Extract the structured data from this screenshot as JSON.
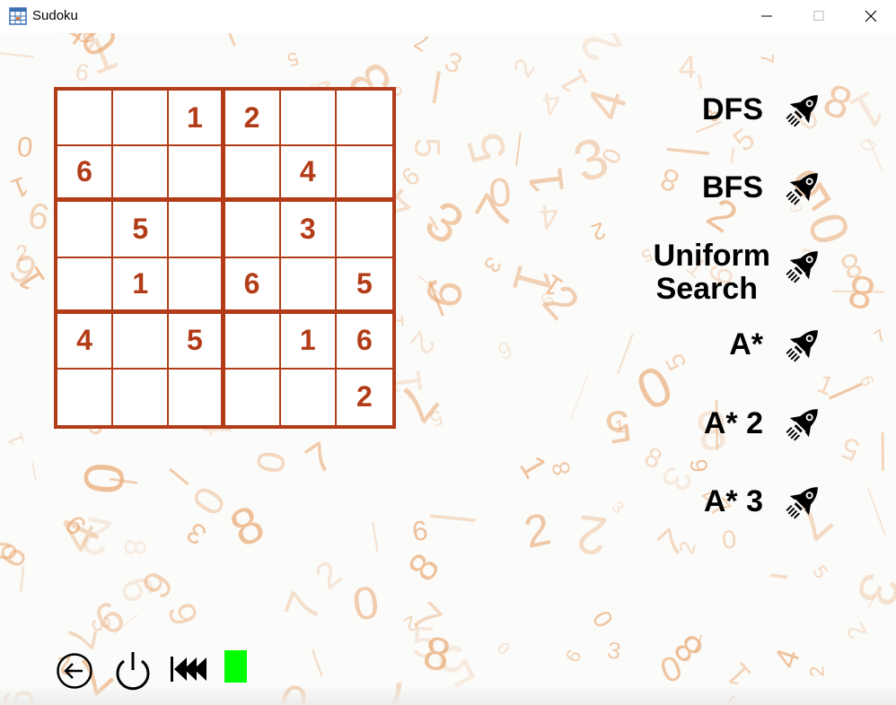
{
  "window": {
    "title": "Sudoku"
  },
  "board": {
    "size": 6,
    "rows": [
      [
        "",
        "",
        "1",
        "2",
        "",
        ""
      ],
      [
        "6",
        "",
        "",
        "",
        "4",
        ""
      ],
      [
        "",
        "5",
        "",
        "",
        "3",
        ""
      ],
      [
        "",
        "1",
        "",
        "6",
        "",
        "5"
      ],
      [
        "4",
        "",
        "5",
        "",
        "1",
        "6"
      ],
      [
        "",
        "",
        "",
        "",
        "",
        "2"
      ]
    ]
  },
  "algorithms": [
    {
      "label": "DFS",
      "icon": "rocket-icon"
    },
    {
      "label": "BFS",
      "icon": "rocket-icon"
    },
    {
      "label": "Uniform Search",
      "line1": "Uniform",
      "line2": "Search",
      "icon": "rocket-icon"
    },
    {
      "label": "A*",
      "icon": "rocket-icon"
    },
    {
      "label": "A* 2",
      "icon": "rocket-icon"
    },
    {
      "label": "A* 3",
      "icon": "rocket-icon"
    }
  ],
  "controls": {
    "back_icon": "back-arrow-icon",
    "power_icon": "power-icon",
    "rewind_icon": "rewind-icon",
    "status_color": "#00ff00"
  },
  "colors": {
    "grid": "#b23c17",
    "background_digits": "#e9a46a"
  }
}
